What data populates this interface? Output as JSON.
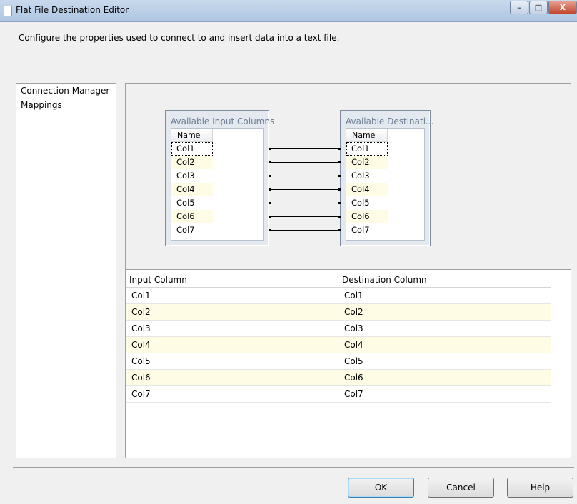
{
  "window": {
    "title": "Flat File Destination Editor",
    "minimize": "–",
    "maximize": "□",
    "close": "X"
  },
  "instruction": "Configure the properties used to connect to and insert data into a text file.",
  "nav": {
    "items": [
      {
        "label": "Connection Manager"
      },
      {
        "label": "Mappings"
      }
    ]
  },
  "input_box": {
    "title": "Available Input Columns",
    "header": "Name",
    "columns": [
      "Col1",
      "Col2",
      "Col3",
      "Col4",
      "Col5",
      "Col6",
      "Col7"
    ]
  },
  "dest_box": {
    "title": "Available Destinati...",
    "header": "Name",
    "columns": [
      "Col1",
      "Col2",
      "Col3",
      "Col4",
      "Col5",
      "Col6",
      "Col7"
    ]
  },
  "grid": {
    "headers": [
      "Input Column",
      "Destination Column"
    ],
    "rows": [
      [
        "Col1",
        "Col1"
      ],
      [
        "Col2",
        "Col2"
      ],
      [
        "Col3",
        "Col3"
      ],
      [
        "Col4",
        "Col4"
      ],
      [
        "Col5",
        "Col5"
      ],
      [
        "Col6",
        "Col6"
      ],
      [
        "Col7",
        "Col7"
      ]
    ]
  },
  "buttons": {
    "ok": "OK",
    "cancel": "Cancel",
    "help": "Help"
  }
}
